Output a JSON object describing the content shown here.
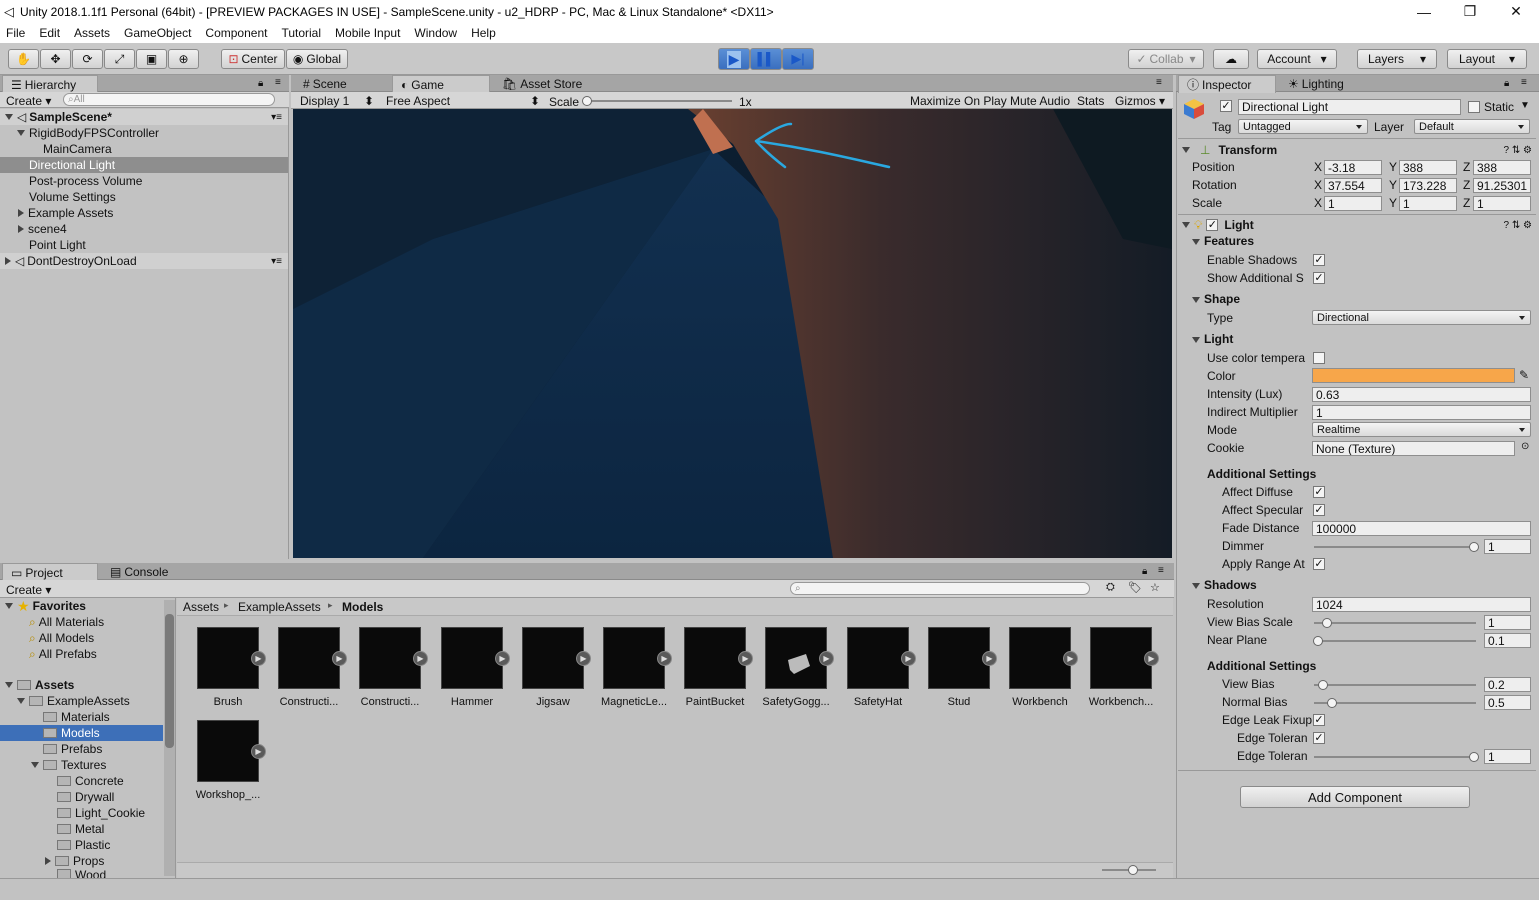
{
  "window": {
    "title": "Unity 2018.1.1f1 Personal (64bit) - [PREVIEW PACKAGES IN USE] - SampleScene.unity - u2_HDRP - PC, Mac & Linux Standalone* <DX11>"
  },
  "menu": [
    "File",
    "Edit",
    "Assets",
    "GameObject",
    "Component",
    "Tutorial",
    "Mobile Input",
    "Window",
    "Help"
  ],
  "toolbar": {
    "center": "Center",
    "global": "Global",
    "collab": "Collab",
    "account": "Account",
    "layers": "Layers",
    "layout": "Layout"
  },
  "hierarchy": {
    "tab": "Hierarchy",
    "create": "Create",
    "search_placeholder": "All",
    "scene": "SampleScene*",
    "items": [
      "RigidBodyFPSController",
      "MainCamera",
      "Directional Light",
      "Post-process Volume",
      "Volume Settings",
      "Example Assets",
      "scene4",
      "Point Light"
    ],
    "dontdestroy": "DontDestroyOnLoad"
  },
  "game": {
    "tabs": [
      "Scene",
      "Game",
      "Asset Store"
    ],
    "display": "Display 1",
    "aspect": "Free Aspect",
    "scale_label": "Scale",
    "scale_value": "1x",
    "maximize": "Maximize On Play",
    "mute": "Mute Audio",
    "stats": "Stats",
    "gizmos": "Gizmos"
  },
  "inspector": {
    "tabs": [
      "Inspector",
      "Lighting"
    ],
    "object_name": "Directional Light",
    "static": "Static",
    "tag_label": "Tag",
    "tag": "Untagged",
    "layer_label": "Layer",
    "layer": "Default",
    "transform": {
      "title": "Transform",
      "position": {
        "label": "Position",
        "x": "-3.18",
        "y": "388",
        "z": "388"
      },
      "rotation": {
        "label": "Rotation",
        "x": "37.554",
        "y": "173.228",
        "z": "91.25301"
      },
      "scale": {
        "label": "Scale",
        "x": "1",
        "y": "1",
        "z": "1"
      }
    },
    "light": {
      "title": "Light",
      "features": "Features",
      "enable_shadows": "Enable Shadows",
      "show_additional": "Show Additional S",
      "shape": "Shape",
      "type_label": "Type",
      "type": "Directional",
      "light_section": "Light",
      "use_color_temp": "Use color tempera",
      "color_label": "Color",
      "color": "#f7a64a",
      "intensity_label": "Intensity (Lux)",
      "intensity": "0.63",
      "indirect_label": "Indirect Multiplier",
      "indirect": "1",
      "mode_label": "Mode",
      "mode": "Realtime",
      "cookie_label": "Cookie",
      "cookie": "None (Texture)",
      "additional": "Additional Settings",
      "affect_diffuse": "Affect Diffuse",
      "affect_specular": "Affect Specular",
      "fade_label": "Fade Distance",
      "fade": "100000",
      "dimmer_label": "Dimmer",
      "dimmer": "1",
      "apply_range": "Apply Range At",
      "shadows": "Shadows",
      "resolution_label": "Resolution",
      "resolution": "1024",
      "view_bias_scale_label": "View Bias Scale",
      "view_bias_scale": "1",
      "near_plane_label": "Near Plane",
      "near_plane": "0.1",
      "additional2": "Additional Settings",
      "view_bias_label": "View Bias",
      "view_bias": "0.2",
      "normal_bias_label": "Normal Bias",
      "normal_bias": "0.5",
      "edge_leak_label": "Edge Leak Fixup",
      "edge_tol1_label": "Edge Toleran",
      "edge_tol2_label": "Edge Toleran",
      "edge_tol2": "1"
    },
    "add_component": "Add Component"
  },
  "project": {
    "tabs": [
      "Project",
      "Console"
    ],
    "create": "Create",
    "breadcrumb": [
      "Assets",
      "ExampleAssets",
      "Models"
    ],
    "favorites": "Favorites",
    "fav_items": [
      "All Materials",
      "All Models",
      "All Prefabs"
    ],
    "assets_root": "Assets",
    "tree": [
      "ExampleAssets",
      "Materials",
      "Models",
      "Prefabs",
      "Textures",
      "Concrete",
      "Drywall",
      "Light_Cookie",
      "Metal",
      "Plastic",
      "Props",
      "Wood"
    ],
    "grid": [
      "Brush",
      "Constructi...",
      "Constructi...",
      "Hammer",
      "Jigsaw",
      "MagneticLe...",
      "PaintBucket",
      "SafetyGogg...",
      "SafetyHat",
      "Stud",
      "Workbench",
      "Workbench...",
      "Workshop_..."
    ]
  }
}
